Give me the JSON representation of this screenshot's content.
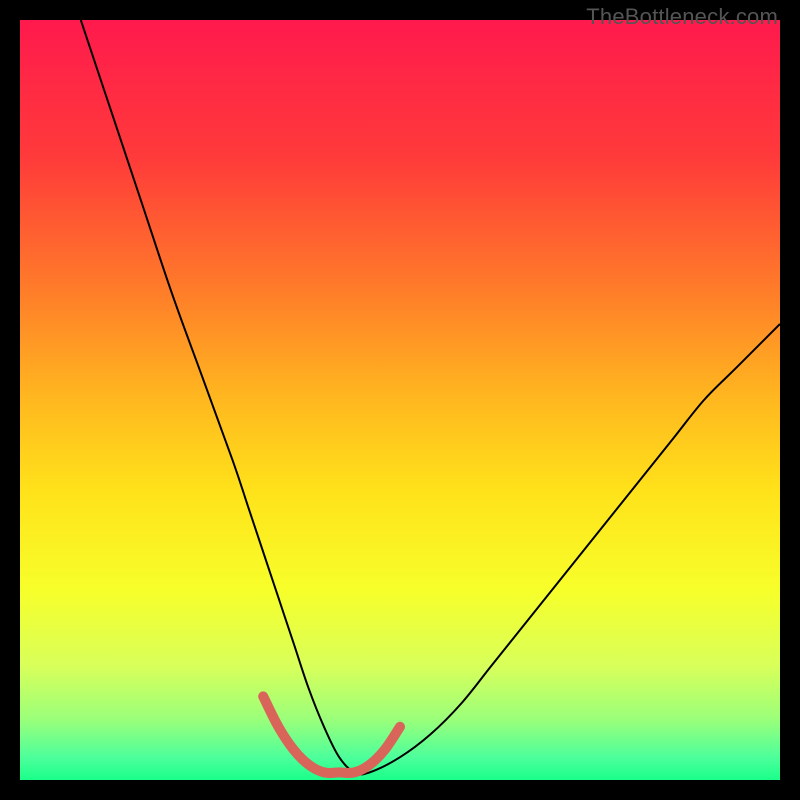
{
  "watermark": "TheBottleneck.com",
  "chart_data": {
    "type": "line",
    "title": "",
    "xlabel": "",
    "ylabel": "",
    "xlim": [
      0,
      100
    ],
    "ylim": [
      0,
      100
    ],
    "background_gradient": {
      "stops": [
        {
          "offset": 0.0,
          "color": "#ff1a4d"
        },
        {
          "offset": 0.18,
          "color": "#ff3a3a"
        },
        {
          "offset": 0.35,
          "color": "#ff7a2a"
        },
        {
          "offset": 0.5,
          "color": "#ffb81f"
        },
        {
          "offset": 0.62,
          "color": "#ffe21a"
        },
        {
          "offset": 0.75,
          "color": "#f7ff2a"
        },
        {
          "offset": 0.85,
          "color": "#d8ff5a"
        },
        {
          "offset": 0.92,
          "color": "#9bff7a"
        },
        {
          "offset": 0.97,
          "color": "#4dff9b"
        },
        {
          "offset": 1.0,
          "color": "#1aff8a"
        }
      ]
    },
    "series": [
      {
        "name": "bottleneck-curve",
        "stroke": "#000000",
        "stroke_width": 2,
        "x": [
          8,
          12,
          16,
          20,
          24,
          28,
          30,
          32,
          34,
          36,
          38,
          40,
          42,
          44,
          46,
          50,
          54,
          58,
          62,
          66,
          70,
          74,
          78,
          82,
          86,
          90,
          94,
          98,
          100
        ],
        "values": [
          100,
          88,
          76,
          64,
          53,
          42,
          36,
          30,
          24,
          18,
          12,
          7,
          3,
          1,
          1,
          3,
          6,
          10,
          15,
          20,
          25,
          30,
          35,
          40,
          45,
          50,
          54,
          58,
          60
        ]
      },
      {
        "name": "valley-highlight",
        "stroke": "#d9645a",
        "stroke_width": 10,
        "linecap": "round",
        "x": [
          32,
          34,
          36,
          38,
          40,
          42,
          44,
          46,
          48,
          50
        ],
        "values": [
          11,
          7,
          4,
          2,
          1,
          1,
          1,
          2,
          4,
          7
        ]
      }
    ]
  }
}
